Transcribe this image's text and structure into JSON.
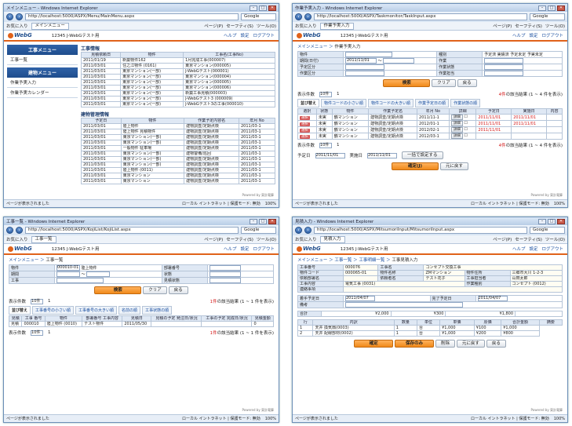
{
  "browser": {
    "title_suffix": " - Windows Internet Explorer",
    "search_engine": "Google",
    "favorites": "お気に入り",
    "cmd_items": [
      "ページ(P)",
      "セーフティ(S)",
      "ツール(O)"
    ],
    "status_done": "ページが表示されました",
    "status_zone": "ローカル イントラネット | 保護モード: 無効",
    "zoom": "100%"
  },
  "app": {
    "logo": "WebG",
    "user": "12345 J-WebGテスト用",
    "help": "ヘルプ",
    "settings": "設定",
    "logout": "ログアウト",
    "powered": "Powered by 東計電算"
  },
  "win1": {
    "title": "メインメニュー",
    "url": "http://localhost:5000/ASPX/Menu/MainMenu.aspx",
    "tab": "メインメニュー",
    "menu_head1": "工事メニュー",
    "menu_items1": [
      "工事一覧"
    ],
    "menu_head2": "建物メニュー",
    "menu_items2": [
      "作業予実入力",
      "作業予実カレンダー"
    ],
    "section1": "工事情報",
    "cols1": [
      "見積依頼日",
      "物件",
      "工事名(工事No)"
    ],
    "rows1": [
      [
        "2011/01/19",
        "新築物件162",
        "1月完成工事(000007)"
      ],
      [
        "2011/03/01",
        "住之江物件 (0161)",
        "東京マンション(000005)"
      ],
      [
        "2011/03/01",
        "東京マンション(一部)",
        "J-WebGテスト(000001)"
      ],
      [
        "2011/03/01",
        "東京マンション(一部)",
        "東京マンション(000004)"
      ],
      [
        "2011/03/01",
        "東京マンション(一部)",
        "東京マンション(000005)"
      ],
      [
        "2011/03/01",
        "東京マンション(一部)",
        "東京マンション(000006)"
      ],
      [
        "2011/03/01",
        "東京マンション(一部)",
        "新築工事見積(000003)"
      ],
      [
        "2011/03/01",
        "東京マンション(一部)",
        "J-WebGテスト3 (000009)"
      ],
      [
        "2011/03/01",
        "東京マンション(一部)",
        "J-WebGテスト3の工事(000010)"
      ]
    ],
    "section2": "建物管理情報",
    "cols2": [
      "予定日",
      "物件",
      "作業予定内容名",
      "年月 No"
    ],
    "rows2": [
      [
        "2011/03/01",
        "陸上物件",
        "建物調査/定期点検",
        "2011/03-1"
      ],
      [
        "2011/03/01",
        "陸上物件 見積物件",
        "建物調査/定期点検",
        "2011/03-1"
      ],
      [
        "2011/03/01",
        "東京マンション(一部)",
        "建物調査/定期点検",
        "2011/03-1"
      ],
      [
        "2011/03/01",
        "東京マンション(一部)",
        "建物調査/定期点検",
        "2011/03-1"
      ],
      [
        "2011/03/01",
        "一般物件 駐車場",
        "建物調査/定期点検",
        "2011/03-1"
      ],
      [
        "2011/03/01",
        "東京マンション(一部)",
        "建物警備/巡回",
        "2011/03-1"
      ],
      [
        "2011/03/01",
        "東京マンション(一部)",
        "建物調査/定期点検",
        "2011/03-1"
      ],
      [
        "2011/03/01",
        "東京マンション(一部)",
        "建物調査/定期点検",
        "2011/03-1"
      ],
      [
        "2011/03/01",
        "陸上物件 (0011)",
        "建物調査/定期点検",
        "2011/03-1"
      ],
      [
        "2011/03/01",
        "東京マンション",
        "建物調査/定期点検",
        "2011/03-1"
      ],
      [
        "2011/03/01",
        "東京マンション",
        "建物調査/定期点検",
        "2011/03-1"
      ]
    ]
  },
  "win2": {
    "title": "作業予実入力",
    "url": "http://localhost:5000/ASPX/Taskmonitor/TaskInput.aspx",
    "tab": "作業予実入力",
    "crumb1": "メインメニュー",
    "crumb2": "作業予実入力",
    "form_labels": [
      "物件",
      "種別",
      "期間(日付)",
      "作業",
      "予定区分",
      "作業状態",
      "作業区分",
      "作業担当"
    ],
    "date_from": "2011/11/01",
    "kind_options": "予定済 実績済 予定未定 予実未定",
    "search_btn": "検索",
    "clear_btn": "クリア",
    "back_btn": "戻る",
    "count_label": "表示件数",
    "count_val": "10件",
    "page": "1",
    "hit": "4件",
    "hit_text": "の該当結果 (1 ~ 4 件を表示)",
    "tabs": [
      "並び替え",
      "物件コードの小さい順",
      "物件コードの大きい順",
      "作業予定日の順",
      "作業状態の順"
    ],
    "cols": [
      "選択",
      "状態",
      "物件",
      "作業予定名",
      "年月 No",
      "詳細",
      "予定日",
      "実施日",
      "内容"
    ],
    "rows": [
      [
        "未実",
        "鶴マンション",
        "建物調査/定期点検",
        "2011/11-1",
        "2011/11/01",
        "2011/11/01"
      ],
      [
        "未実",
        "鶴マンション",
        "建物調査/定期点検",
        "2012/01-1",
        "2011/11/01",
        "2011/11/01"
      ],
      [
        "未実",
        "鶴マンション",
        "建物調査/定期点検",
        "2012/02-1",
        "2011/11/01",
        ""
      ],
      [
        "未実",
        "鶴マンション",
        "建物調査/定期点検",
        "2012/03-1",
        "",
        ""
      ]
    ],
    "plan_label": "予定日",
    "actual_label": "実施日",
    "plan_date": "2011/11/01",
    "actual_date": "2011/11/01",
    "bulk_btn": "一括で設定する",
    "confirm_btn": "確定(J)",
    "restore_btn": "元に戻す"
  },
  "win3": {
    "title": "工事一覧",
    "url": "http://localhost:5000/ASPX/KojiList/KojiList.aspx",
    "tab": "工事一覧",
    "crumb1": "メインメニュー",
    "crumb2": "工事一覧",
    "labels": [
      "物件",
      "期間",
      "工事",
      "部署番号",
      "状態",
      "見積状態"
    ],
    "bukken_code": "000010-01",
    "bukken_name": "陸上物件",
    "search_btn": "検索",
    "clear_btn": "クリア",
    "back_btn": "戻る",
    "count_label": "表示件数",
    "count_val": "10件",
    "page": "1",
    "hit": "1件",
    "hit_text": "の該当結果 (1 ~ 1 件を表示)",
    "tabs": [
      "並び替え",
      "工事番号の小さい順",
      "工事番号の大きい順",
      "名前の順",
      "工事状態の順"
    ],
    "cols": [
      "見積",
      "工事 番号",
      "物件",
      "部署番号 工事内容",
      "見積日",
      "見積の予定 発注日/状況",
      "工事の予定 完成日/状況",
      "見積金額"
    ],
    "rows": [
      [
        "見積",
        "000010",
        "陸上物件 (0010)",
        "テスト物件",
        "2011/05/30",
        "",
        "",
        "0"
      ]
    ]
  },
  "win4": {
    "title": "見積入力",
    "url": "http://localhost:5000/ASPX/MitsumoriInput/MitsumoriInput.aspx",
    "tab": "見積入力",
    "crumb": [
      "メインメニュー",
      "工事一覧",
      "工事明細一覧",
      "工事見積入力"
    ],
    "info": [
      [
        "工事番号",
        "000076",
        "工事名",
        "コンセプト交換工事"
      ],
      [
        "物件コード",
        "000065-01",
        "物件名称",
        "ZMマンション",
        "物件住所",
        "三郷市大川 1-2-3"
      ],
      [
        "依頼部署名",
        "",
        "依頼者名",
        "テスト花子",
        "工事担当者",
        "山田太郎"
      ],
      [
        "工事内容",
        "電気工事 (0031)",
        "",
        "",
        "作業種別",
        "コンセプト (0012)"
      ],
      [
        "連絡事項",
        ""
      ]
    ],
    "date_labels": [
      "着手予定日",
      "完了予定日"
    ],
    "start_date": "2011/04/07",
    "end_date": "2011/04/07",
    "remarks_label": "備考",
    "total_label": "合計",
    "total_vals": [
      "¥2,000",
      "¥300",
      "¥1,800"
    ],
    "cols": [
      "行",
      "内訳",
      "数量",
      "単位",
      "単価",
      "原価",
      "合計金額",
      "摘要"
    ],
    "rows": [
      [
        "1",
        "天井 換気扇(0003)",
        "1",
        "台",
        "¥1,000",
        "¥100",
        "¥1,000"
      ],
      [
        "2",
        "天井 配線部材(0002)",
        "1",
        "台",
        "¥1,000",
        "¥200",
        "¥800"
      ]
    ],
    "buttons": [
      "確定",
      "保存のみ",
      "削除",
      "元に戻す",
      "戻る"
    ]
  }
}
